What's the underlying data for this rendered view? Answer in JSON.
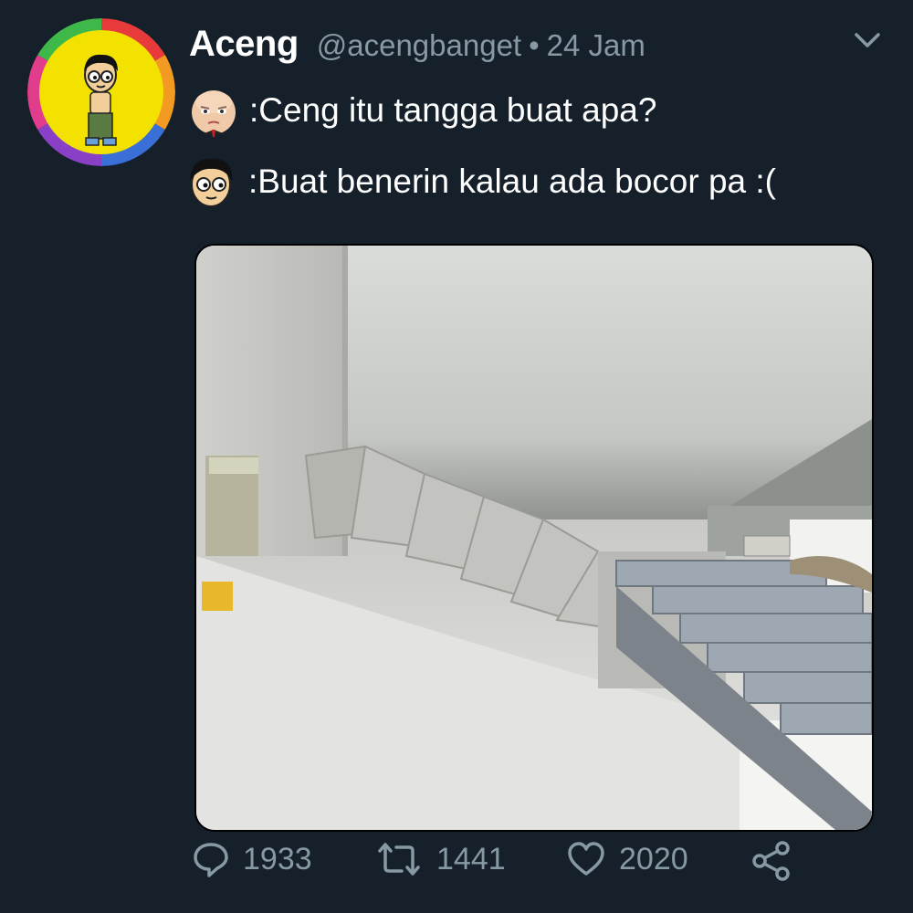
{
  "tweet": {
    "author_name": "Aceng",
    "handle": "@acengbanget",
    "separator": "•",
    "time": "24 Jam",
    "lines": [
      {
        "speaker_icon": "baby-face-emoji-icon",
        "text": ":Ceng itu tangga buat apa?"
      },
      {
        "speaker_icon": "cartoon-boy-face-emoji-icon",
        "text": ":Buat benerin kalau ada bocor pa :("
      }
    ]
  },
  "actions": {
    "replies": "1933",
    "retweets": "1441",
    "likes": "2020"
  },
  "icons": [
    "avatar-cartoon-boy-icon",
    "chevron-down-icon",
    "reply-icon",
    "retweet-icon",
    "like-icon",
    "share-icon"
  ],
  "colors": {
    "background": "#15202b",
    "muted": "#8899a6",
    "text": "#ffffff"
  }
}
